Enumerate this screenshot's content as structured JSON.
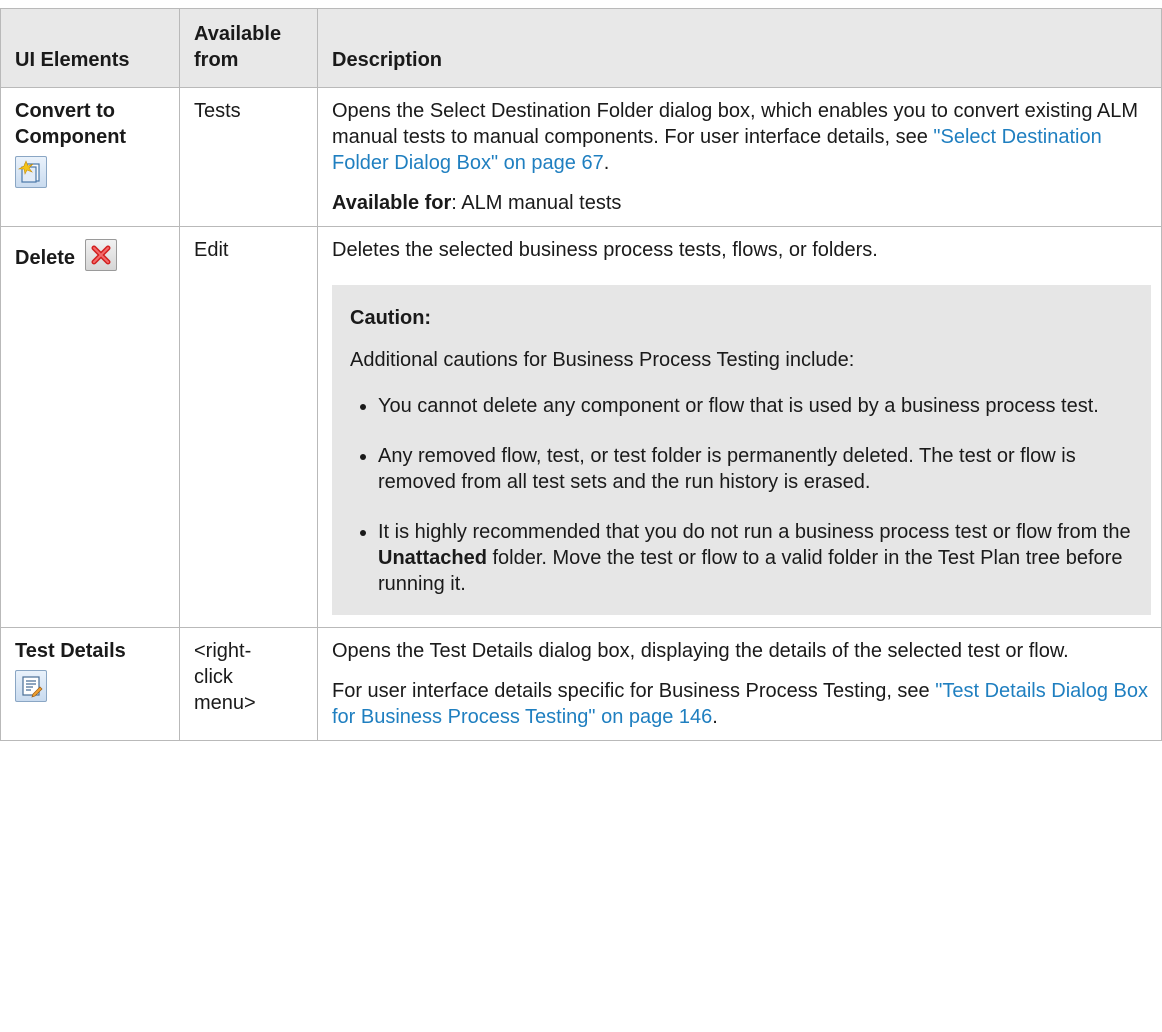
{
  "headers": [
    "UI Elements",
    "Available from",
    "Description"
  ],
  "rows": [
    {
      "name": "Convert to Component",
      "available": "Tests",
      "desc_main": "Opens the Select Destination Folder dialog box, which enables you to convert existing ALM manual tests to manual components. For user interface details, see ",
      "desc_link": "\"Select Destination Folder Dialog Box\" on page 67",
      "desc_end": ".",
      "avail_for_label": "Available for",
      "avail_for_value": ": ALM manual tests",
      "icon": "convert-to-component-icon"
    },
    {
      "name": "Delete",
      "available": "Edit",
      "desc_main": "Deletes the selected business process tests, flows, or folders.",
      "caution_title": "Caution:",
      "caution_intro": "Additional cautions for Business Process Testing include:",
      "bullets": [
        "You cannot delete any component or flow that is used by a business process test.",
        "Any removed flow, test, or test folder is permanently deleted. The test or flow is removed from all test sets and the run history is erased."
      ],
      "bullet3_a": "It is highly recommended that you do not run a business process test or flow from the ",
      "bullet3_bold": "Unattached",
      "bullet3_b": " folder. Move the test or flow to a valid folder in the Test Plan tree before running it.",
      "icon": "delete-icon"
    },
    {
      "name": "Test Details",
      "available": "<right-click menu>",
      "desc_main": "Opens the Test Details dialog box, displaying the details of the selected test or flow.",
      "desc2": "For user interface details specific for Business Process Testing, see ",
      "desc2_link": "\"Test Details Dialog Box for Business Process Testing\" on page 146",
      "desc2_end": ".",
      "icon": "test-details-icon"
    }
  ],
  "colors": {
    "link": "#1f7fc0",
    "header_bg": "#e8e8e8",
    "caution_bg": "#e6e6e6",
    "border": "#b9b9b9"
  }
}
